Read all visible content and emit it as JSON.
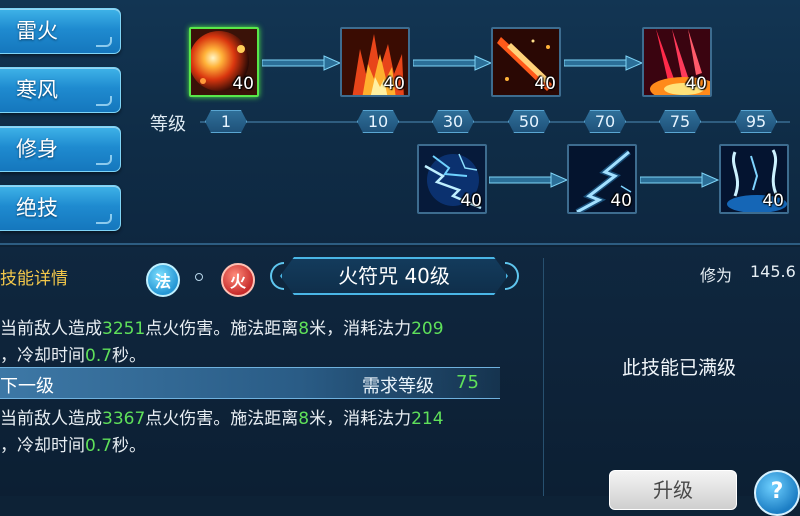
{
  "tabs": [
    {
      "label": "雷火"
    },
    {
      "label": "寒风"
    },
    {
      "label": "修身"
    },
    {
      "label": "绝技"
    }
  ],
  "skill_tree": {
    "fire_row": [
      {
        "level": "40",
        "icon": "fireball-icon",
        "selected": true
      },
      {
        "level": "40",
        "icon": "flame-pillar-icon"
      },
      {
        "level": "40",
        "icon": "fire-slash-icon"
      },
      {
        "level": "40",
        "icon": "fire-rain-icon"
      }
    ],
    "thunder_row": [
      {
        "level": "40",
        "icon": "lightning-icon"
      },
      {
        "level": "40",
        "icon": "lightning-chain-icon"
      },
      {
        "level": "40",
        "icon": "thunder-storm-icon"
      }
    ]
  },
  "level_bar": {
    "label": "等级",
    "levels": [
      "1",
      "10",
      "30",
      "50",
      "70",
      "75",
      "95"
    ]
  },
  "detail": {
    "title": "技能详情",
    "badge_school": "法",
    "badge_element": "火",
    "skill_name": "火符咒 40级",
    "current": {
      "line1_a": "当前敌人造成",
      "damage": "3251",
      "line1_b": "点火伤害。施法距离",
      "range": "8",
      "line1_c": "米，消耗法力",
      "mana": "209",
      "line2_a": "，冷却时间",
      "cooldown": "0.7",
      "line2_b": "秒。"
    },
    "next_label": "下一级",
    "req_label": "需求等级",
    "req_value": "75",
    "next": {
      "line1_a": "当前敌人造成",
      "damage": "3367",
      "line1_b": "点火伤害。施法距离",
      "range": "8",
      "line1_c": "米，消耗法力",
      "mana": "214",
      "line2_a": "，冷却时间",
      "cooldown": "0.7",
      "line2_b": "秒。"
    }
  },
  "side": {
    "cultivation_label": "修为",
    "cultivation_value": "145.6",
    "maxed_text": "此技能已满级",
    "upgrade_label": "升级",
    "help_label": "?"
  }
}
